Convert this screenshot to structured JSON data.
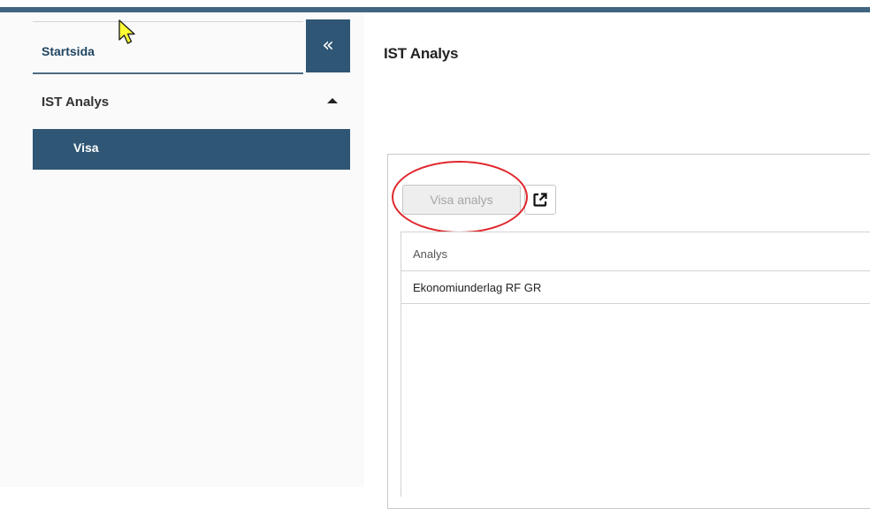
{
  "colors": {
    "accent": "#2f5674",
    "highlight": "#e0272d"
  },
  "sidebar": {
    "start_link": "Startsida",
    "collapse_icon": "double-chevron-left-icon",
    "collapse_glyph": "«",
    "section_label": "IST Analys",
    "section_caret": "caret-up-icon",
    "active_item": "Visa"
  },
  "main": {
    "title": "IST Analys",
    "toolbar": {
      "visa_analys": "Visa analys",
      "export_icon": "external-link-icon"
    },
    "table": {
      "column_header": "Analys",
      "rows": [
        "Ekonomiunderlag RF GR"
      ]
    }
  }
}
